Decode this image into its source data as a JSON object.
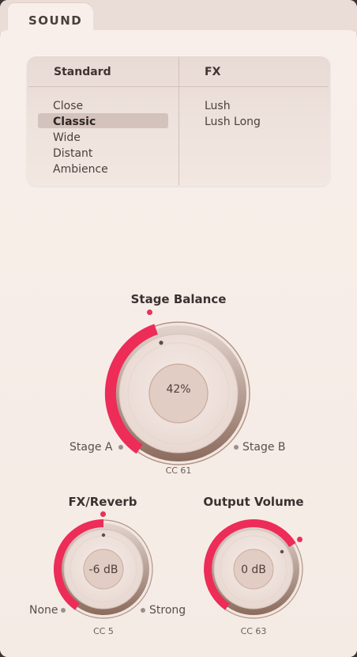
{
  "tab": {
    "label": "SOUND"
  },
  "presets": {
    "standard_header": "Standard",
    "fx_header": "FX",
    "standard_items": [
      "Close",
      "Classic",
      "Wide",
      "Distant",
      "Ambience"
    ],
    "fx_items": [
      "Lush",
      "Lush Long"
    ],
    "selected": "Classic"
  },
  "stage_balance": {
    "title": "Stage Balance",
    "value": "42%",
    "level": 0.42,
    "left_label": "Stage A",
    "right_label": "Stage B",
    "cc": "CC 61"
  },
  "fx_reverb": {
    "title": "FX/Reverb",
    "value": "-6 dB",
    "left_label": "None",
    "right_label": "Strong",
    "cc": "CC 5"
  },
  "output_volume": {
    "title": "Output Volume",
    "value": "0 dB",
    "cc": "CC 63"
  },
  "colors": {
    "accent": "#e8325a",
    "ring": "#a6826f",
    "panel_bg": "#f5ebe5"
  }
}
